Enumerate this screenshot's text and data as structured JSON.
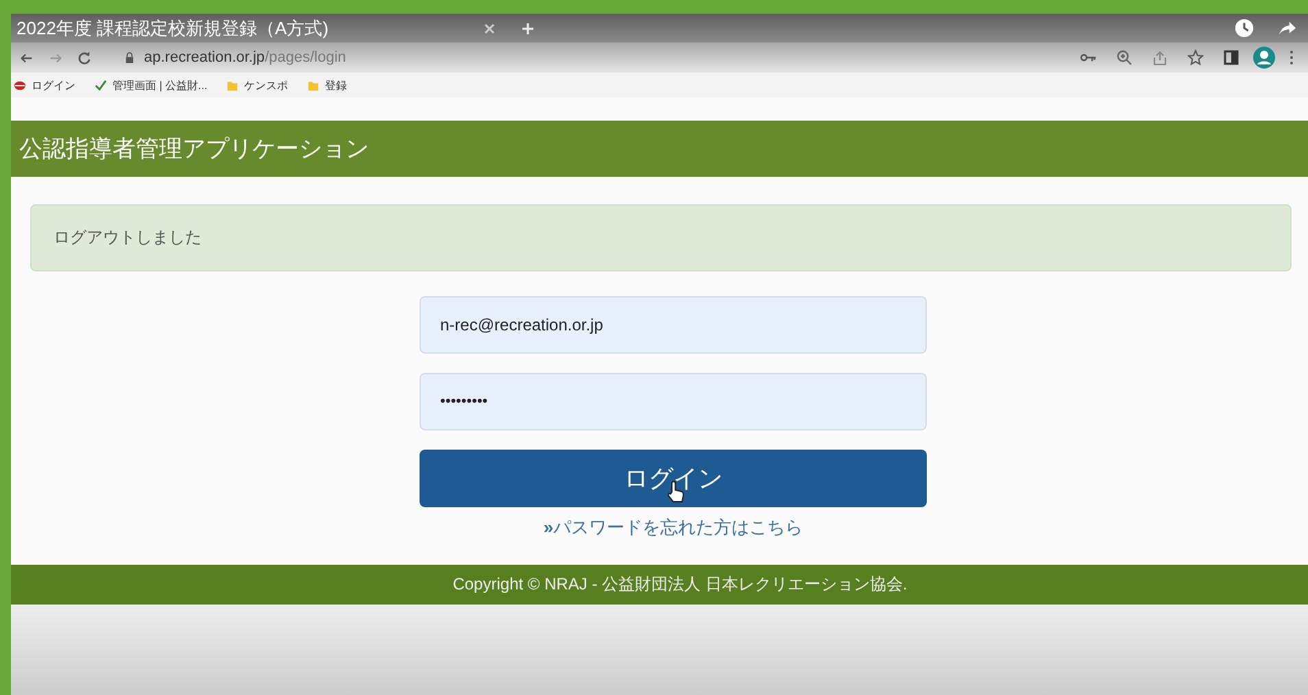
{
  "browser": {
    "tab_title": "2022年度 課程認定校新規登録（A方式)",
    "url_host": "ap.recreation.or.jp",
    "url_path": "/pages/login",
    "bookmarks": [
      {
        "label": "ログイン",
        "kind": "site"
      },
      {
        "label": "管理画面 | 公益財...",
        "kind": "check"
      },
      {
        "label": "ケンスポ",
        "kind": "folder"
      },
      {
        "label": "登録",
        "kind": "folder"
      }
    ]
  },
  "app": {
    "title": "公認指導者管理アプリケーション"
  },
  "alert": {
    "message": "ログアウトしました"
  },
  "login_form": {
    "email": {
      "value": "n-rec@recreation.or.jp"
    },
    "password": {
      "value": "•••••••••"
    },
    "submit": "ログイン",
    "forgot_link": "パスワードを忘れた方はこちら",
    "link_mark": "»"
  },
  "footer": {
    "text": "Copyright © NRAJ - 公益財団法人 日本レクリエーション協会."
  }
}
